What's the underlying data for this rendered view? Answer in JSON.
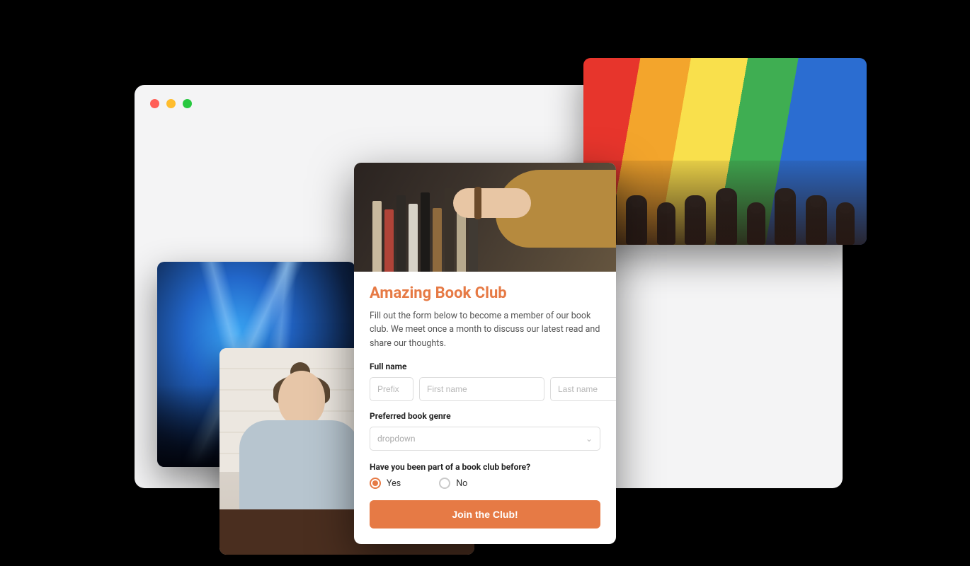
{
  "form": {
    "title": "Amazing Book Club",
    "description": "Fill out the form below to become a member of our book club. We meet once a month to discuss our latest read and share our thoughts.",
    "fullname_label": "Full name",
    "prefix_placeholder": "Prefix",
    "firstname_placeholder": "First name",
    "lastname_placeholder": "Last name",
    "genre_label": "Preferred book genre",
    "genre_placeholder": "dropdown",
    "prior_label": "Have you been part of a book club before?",
    "option_yes": "Yes",
    "option_no": "No",
    "selected_option": "Yes",
    "submit_label": "Join the Club!"
  },
  "colors": {
    "accent": "#e67a45"
  }
}
